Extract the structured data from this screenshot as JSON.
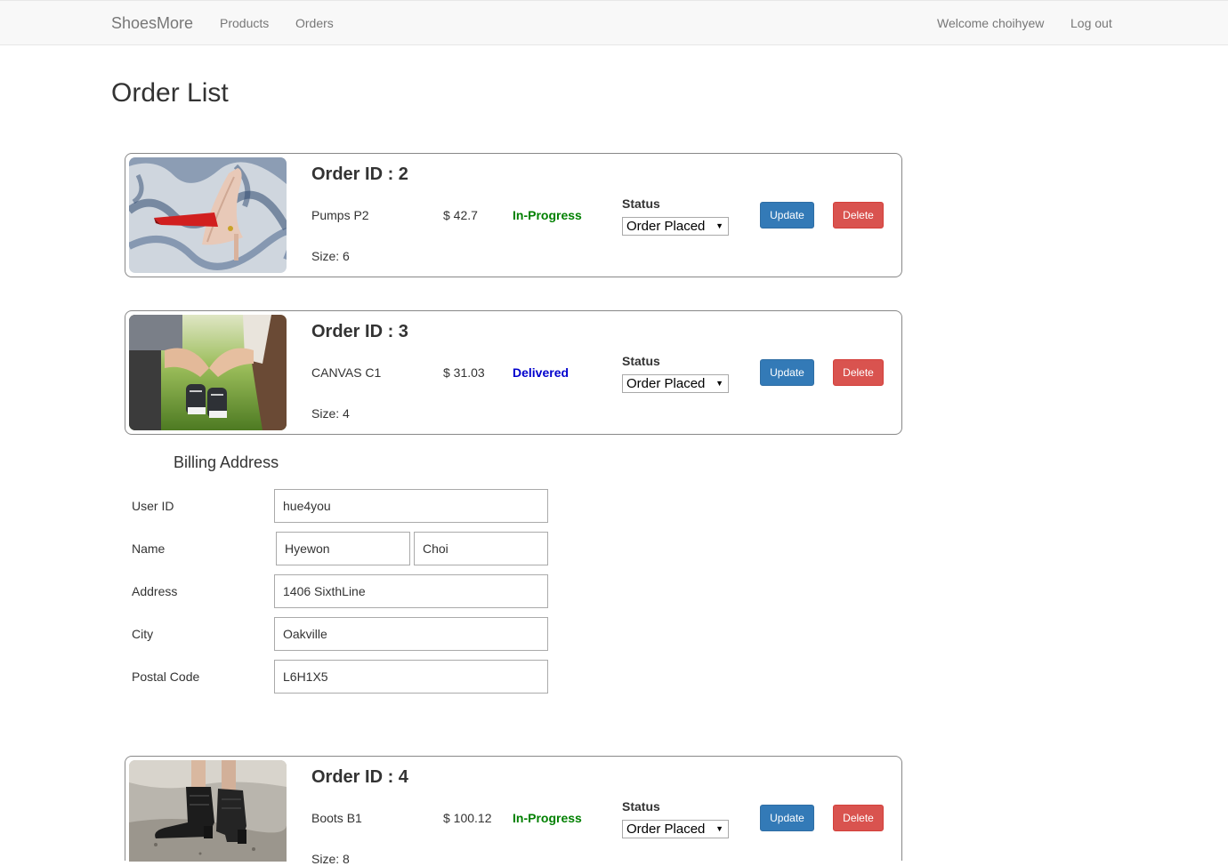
{
  "nav": {
    "brand": "ShoesMore",
    "products": "Products",
    "orders": "Orders",
    "welcome": "Welcome choihyew",
    "logout": "Log out"
  },
  "page_title": "Order List",
  "orders": [
    {
      "id_label": "Order ID : 2",
      "product": "Pumps P2",
      "price": "$ 42.7",
      "progress": "In-Progress",
      "progress_color": "#008000",
      "status_label": "Status",
      "status_value": "Order Placed",
      "update_label": "Update",
      "delete_label": "Delete",
      "size": "Size: 6",
      "image": "red-high-heel-pump-photo"
    },
    {
      "id_label": "Order ID : 3",
      "product": "CANVAS C1",
      "price": "$ 31.03",
      "progress": "Delivered",
      "progress_color": "#0000cd",
      "status_label": "Status",
      "status_value": "Order Placed",
      "update_label": "Update",
      "delete_label": "Delete",
      "size": "Size: 4",
      "image": "baby-sneakers-photo"
    },
    {
      "id_label": "Order ID : 4",
      "product": "Boots B1",
      "price": "$ 100.12",
      "progress": "In-Progress",
      "progress_color": "#008000",
      "status_label": "Status",
      "status_value": "Order Placed",
      "update_label": "Update",
      "delete_label": "Delete",
      "size": "Size: 8",
      "image": "black-ankle-boots-photo"
    }
  ],
  "billing": {
    "title": "Billing Address",
    "user_id_label": "User ID",
    "user_id": "hue4you",
    "name_label": "Name",
    "first_name": "Hyewon",
    "last_name": "Choi",
    "address_label": "Address",
    "address": "1406 SixthLine",
    "city_label": "City",
    "city": "Oakville",
    "postal_label": "Postal Code",
    "postal": "L6H1X5"
  },
  "colors": {
    "update_button": "#337ab7",
    "delete_button": "#d9534f",
    "in_progress": "#008000",
    "delivered": "#0000cd"
  }
}
